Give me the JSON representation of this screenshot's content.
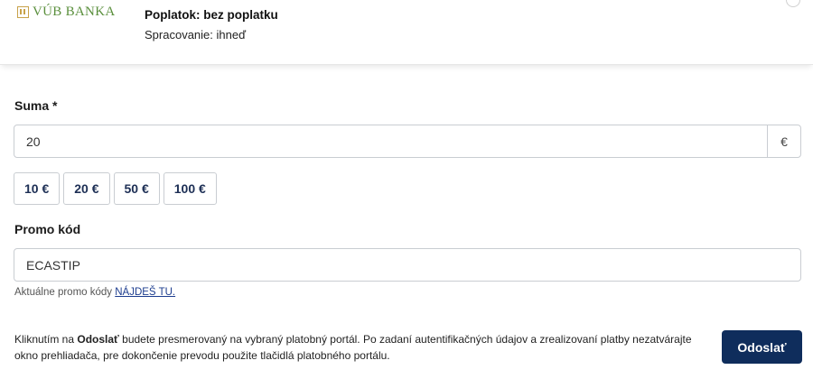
{
  "bank": {
    "name": "VÚB BANKA",
    "logo_icon": "vub-logo-icon",
    "fee": "Poplatok: bez poplatku",
    "processing": "Spracovanie: ihneď"
  },
  "amount": {
    "label": "Suma *",
    "value": "20",
    "currency": "€",
    "presets": [
      "10 €",
      "20 €",
      "50 €",
      "100 €"
    ]
  },
  "promo": {
    "label": "Promo kód",
    "value": "ECASTIP",
    "hint_prefix": "Aktuálne promo kódy ",
    "hint_link": "NÁJDEŠ TU."
  },
  "info": {
    "prefix": "Kliknutím na ",
    "bold": "Odoslať",
    "suffix": " budete presmerovaný na vybraný platobný portál. Po zadaní autentifikačných údajov a zrealizovaní platby nezatvárajte okno prehliadača, pre dokončenie prevodu použite tlačidlá platobného portálu."
  },
  "submit_label": "Odoslať",
  "colors": {
    "primary": "#0f2d5c",
    "logo_text": "#5a8f3c",
    "logo_mark": "#c8a24a",
    "link": "#1d3d8f"
  }
}
